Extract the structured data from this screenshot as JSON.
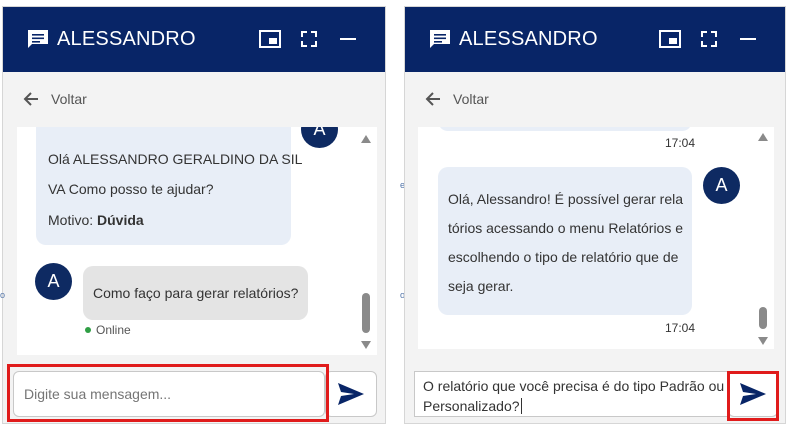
{
  "panels": [
    {
      "header": {
        "title": "ALESSANDRO"
      },
      "back_label": "Voltar",
      "agent_avatar": "A",
      "user_avatar": "A",
      "greeting": {
        "line1": "Olá ALESSANDRO GERALDINO DA SIL",
        "line2": "VA Como posso te ajudar?",
        "reason_label": "Motivo:",
        "reason_value": "Dúvida"
      },
      "user_message": "Como faço para gerar relatórios?",
      "status": "Online",
      "input_placeholder": "Digite sua mensagem...",
      "input_value": ""
    },
    {
      "header": {
        "title": "ALESSANDRO"
      },
      "back_label": "Voltar",
      "prev_time": "17:04",
      "agent_avatar": "A",
      "reply": {
        "line1": "Olá, Alessandro! É possível gerar rela",
        "line2": "tórios acessando o menu Relatórios e",
        "line3": "escolhendo o tipo de relatório que de",
        "line4": "seja gerar."
      },
      "reply_time": "17:04",
      "input_line1": "O relatório que você precisa é do tipo Padrão ou",
      "input_line2": "Personalizado?"
    }
  ],
  "colors": {
    "header": "#082567",
    "avatar": "#0e2a62",
    "highlight": "#e01b1b",
    "online": "#2f9e44"
  },
  "icons": [
    "chat-icon",
    "picture-in-picture-icon",
    "fullscreen-icon",
    "minimize-icon",
    "arrow-left-icon",
    "send-icon"
  ]
}
